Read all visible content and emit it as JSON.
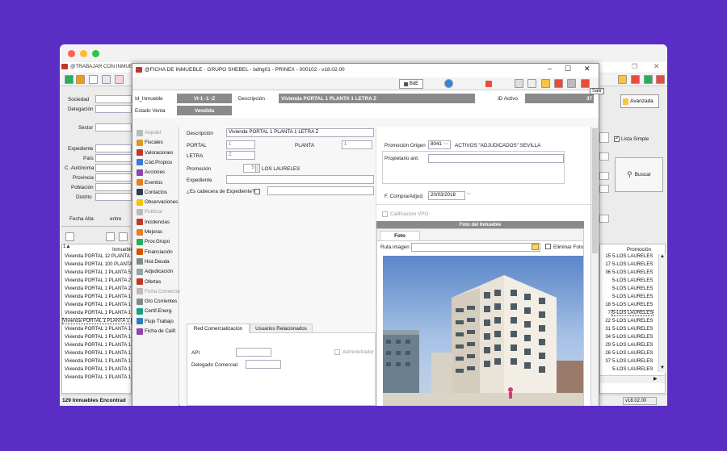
{
  "background": {
    "color": "#5a2ec4"
  },
  "bg_window": {
    "title": "@TRABAJAR CON INMUE",
    "labels": {
      "sociedad": "Sociedad",
      "delegacion": "Delegación",
      "sector": "Sector",
      "expediente": "Expediente",
      "pais": "País",
      "c_autonoma": "C. Autónoma",
      "provincia": "Provincia",
      "poblacion": "Población",
      "distrito": "Distrito",
      "fecha_alta": "Fecha Alta",
      "entre": "entre"
    },
    "inmueble_header": "Inmueble",
    "rows": [
      "Vivienda  PORTAL 12 PLANTA 1",
      "Vivienda  PORTAL 100 PLANTA",
      "Vivienda  PORTAL 1 PLANTA 5 L",
      "Vivienda  PORTAL 1 PLANTA 2 L",
      "Vivienda  PORTAL 1 PLANTA 2 L",
      "Vivienda  PORTAL 1 PLANTA 1 L",
      "Vivienda  PORTAL 1 PLANTA 1 L",
      "Vivienda  PORTAL 1 PLANTA 1 L",
      "Vivienda  PORTAL 1 PLANTA 1 L",
      "Vivienda  PORTAL 1 PLANTA 1 L",
      "Vivienda  PORTAL 1 PLANTA 1 L",
      "Vivienda  PORTAL 1 PLANTA 1 L",
      "Vivienda  PORTAL 1 PLANTA 1 L",
      "Vivienda  PORTAL 1 PLANTA 1 L",
      "Vivienda  PORTAL 1 PLANTA 1 L",
      "Vivienda  PORTAL 1 PLANTA 1 L"
    ],
    "status": "129 Inmuebles Encontrad",
    "right": {
      "avanzada": "Avanzada",
      "lista_simple": "Lista Simple",
      "buscar": "Buscar",
      "promocion_header": "Promoción",
      "rows": [
        {
          "n": "15",
          "p": "5-LOS LAURELES"
        },
        {
          "n": "17",
          "p": "5-LOS LAURELES"
        },
        {
          "n": "36",
          "p": "5-LOS LAURELES"
        },
        {
          "n": "",
          "p": "5-LOS LAURELES"
        },
        {
          "n": "",
          "p": "5-LOS LAURELES"
        },
        {
          "n": "",
          "p": "5-LOS LAURELES"
        },
        {
          "n": "18",
          "p": "5-LOS LAURELES"
        },
        {
          "n": "7",
          "p": "5-LOS LAURELES"
        },
        {
          "n": "22",
          "p": "5-LOS LAURELES"
        },
        {
          "n": "31",
          "p": "5-LOS LAURELES"
        },
        {
          "n": "34",
          "p": "5-LOS LAURELES"
        },
        {
          "n": "29",
          "p": "5-LOS LAURELES"
        },
        {
          "n": "26",
          "p": "5-LOS LAURELES"
        },
        {
          "n": "37",
          "p": "5-LOS LAURELES"
        },
        {
          "n": "",
          "p": "5-LOS LAURELES"
        }
      ],
      "version": "v18.02.00"
    }
  },
  "dialog": {
    "title": "@FICHA DE INMUEBLE - GRUPO SHEBEL - bdhg01 - PRINEX - 000102 - v18.02.00",
    "bde": "BdE",
    "tooltip": "Salir",
    "id_inmueble_label": "Id_Inmueble",
    "id_inmueble_value": "VI-1 -1 -Z",
    "descripcion_label": "Descripción",
    "descripcion_value": "Vivienda  PORTAL 1 PLANTA 1 LETRA Z",
    "id_activo_label": "ID Activo",
    "id_activo_value": "37",
    "estado_venta_label": "Estado Venta",
    "estado_venta_value": "Vendida",
    "nav": [
      {
        "label": "Alquiler",
        "color": "#bbb",
        "disabled": true
      },
      {
        "label": "Fiscales",
        "color": "#d99a2b"
      },
      {
        "label": "Valoraciones",
        "color": "#c0392b"
      },
      {
        "label": "Cód.Propios",
        "color": "#3a7bd5"
      },
      {
        "label": "Acciones",
        "color": "#8e44ad"
      },
      {
        "label": "Eventos",
        "color": "#e67e22"
      },
      {
        "label": "Contactos",
        "color": "#2c3e50"
      },
      {
        "label": "Observaciones",
        "color": "#f1c40f"
      },
      {
        "label": "Publicar",
        "color": "#bbb",
        "disabled": true
      },
      {
        "label": "Incidencias",
        "color": "#c0392b"
      },
      {
        "label": "Mejoras",
        "color": "#e67e22"
      },
      {
        "label": "Prov.Grupo",
        "color": "#27ae60"
      },
      {
        "label": "Financiación",
        "color": "#d35400"
      },
      {
        "label": "Hist.Deuda",
        "color": "#7f8c8d"
      },
      {
        "label": "Adjudicación",
        "color": "#95a5a6"
      },
      {
        "label": "Ofertas",
        "color": "#c0392b"
      },
      {
        "label": "Ficha Comercial",
        "color": "#bbb",
        "disabled": true
      },
      {
        "label": "Gto Corrientes",
        "color": "#7f8c8d"
      },
      {
        "label": "Certif.Energ.",
        "color": "#16a085"
      },
      {
        "label": "Flujo Trabajo",
        "color": "#2980b9"
      },
      {
        "label": "Ficha de Calif.",
        "color": "#8e44ad"
      }
    ],
    "form": {
      "descripcion_label": "Descripción",
      "descripcion_value": "Vivienda  PORTAL 1 PLANTA 1 LETRA Z",
      "portal_label": "PORTAL",
      "portal_value": "1",
      "planta_label": "PLANTA",
      "planta_value": "1",
      "letra_label": "LETRA",
      "letra_value": "Z",
      "promocion_label": "Promoción",
      "promocion_value": "5",
      "promocion_name": "LOS LAURELES",
      "expediente_label": "Expediente",
      "cabecera_label": "¿Es cabecera de Expediente?",
      "promocion_origen_label": "Promoción Origen",
      "promocion_origen_value": "8041",
      "promocion_origen_name": "ACTIVOS \"ADJUDICADOS\" SEVILLA",
      "propietario_label": "Propietario ant.",
      "f_compra_label": "F. Compra/Adjud.",
      "f_compra_value": "20/03/2018",
      "calificacion_label": "Calificación VPO",
      "foto_header": "Foto del Inmueble",
      "foto_tab": "Foto",
      "ruta_label": "Ruta imagen",
      "eliminar_label": "Eliminar Foto",
      "tab_red": "Red Comercialización",
      "tab_usuarios": "Usuarios Relacionados",
      "api_label": "API",
      "administrador_label": "Administrador",
      "delegado_label": "Delegado Comercial"
    }
  }
}
